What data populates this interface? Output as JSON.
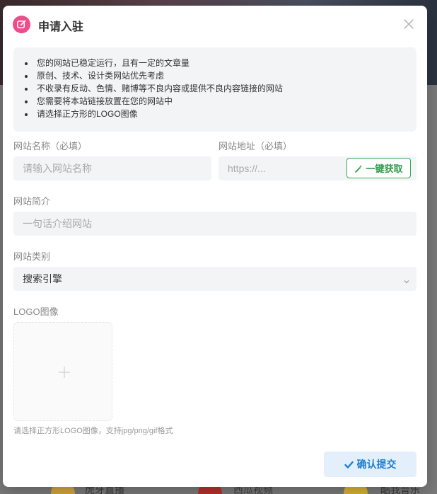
{
  "background": {
    "items": [
      "虎牙直播",
      "西瓜视频",
      "酷我音乐"
    ]
  },
  "dialog": {
    "title": "申请入驻",
    "title_icon": "edit-icon",
    "accent_color": "#ee4d8c",
    "close_icon": "close-icon"
  },
  "notice": {
    "items": [
      "您的网站已稳定运行，且有一定的文章量",
      "原创、技术、设计类网站优先考虑",
      "不收录有反动、色情、赌博等不良内容或提供不良内容链接的网站",
      "您需要将本站链接放置在您的网站中",
      "请选择正方形的LOGO图像"
    ]
  },
  "form": {
    "name": {
      "label": "网站名称（必填）",
      "placeholder": "请输入网站名称"
    },
    "url": {
      "label": "网站地址（必填）",
      "placeholder": "https://...",
      "fetch_label": "一键获取",
      "fetch_color": "#2f9a48"
    },
    "intro": {
      "label": "网站简介",
      "placeholder": "一句话介绍网站"
    },
    "category": {
      "label": "网站类别",
      "value": "搜索引擎"
    },
    "logo": {
      "label": "LOGO图像",
      "hint": "请选择正方形LOGO图像，支持jpg/png/gif格式"
    }
  },
  "submit": {
    "label": "确认提交",
    "color": "#1f7fd0"
  }
}
